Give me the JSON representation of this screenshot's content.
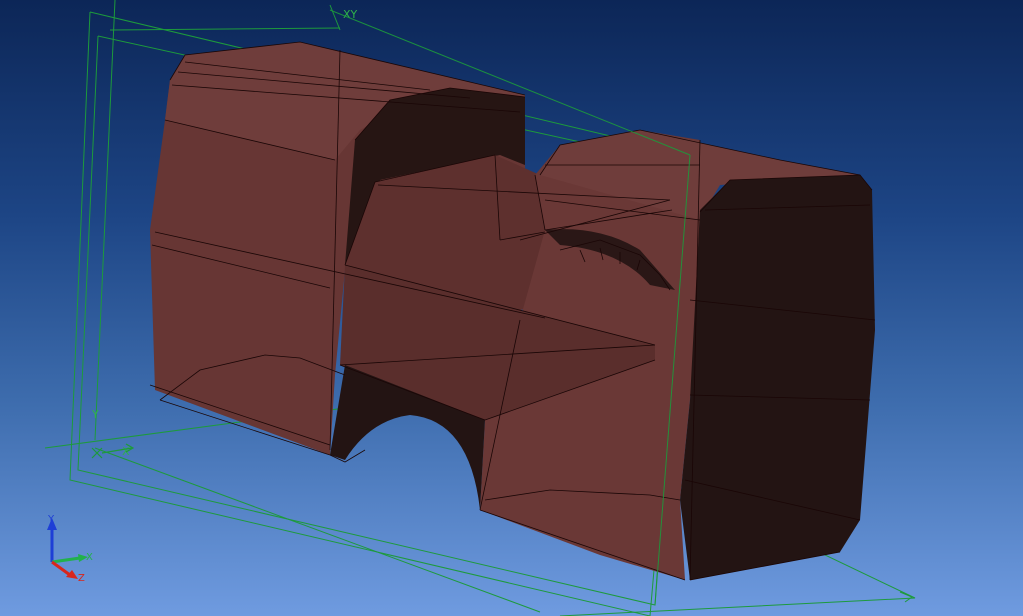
{
  "viewport": {
    "background_top": "#0c2657",
    "background_bottom": "#6f9be0"
  },
  "datum_planes": {
    "color": "#1d9a3c",
    "xy_label": "XY",
    "x_label": "X",
    "y_label": "Y"
  },
  "part": {
    "color_light": "#6b3a38",
    "color_dark": "#241514",
    "edge_color": "#1a0606"
  },
  "triad": {
    "x_label": "X",
    "y_label": "Y",
    "z_label": "Z",
    "x_color": "#22b14c",
    "y_color": "#1e3fd6",
    "z_color": "#d8261c"
  }
}
